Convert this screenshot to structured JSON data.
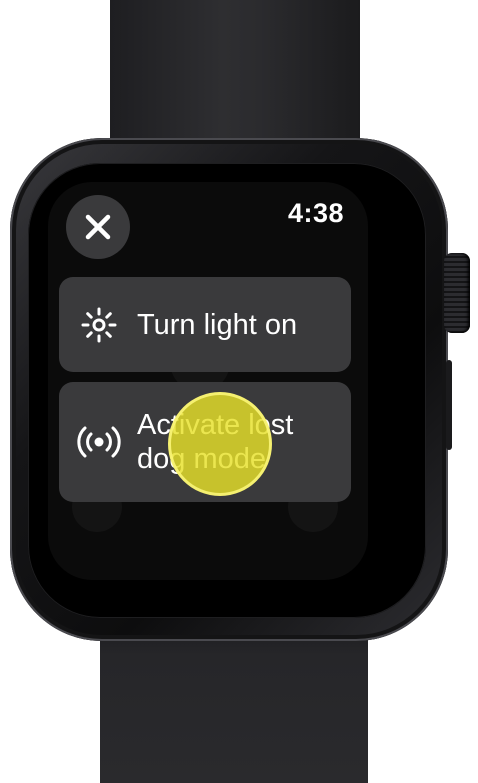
{
  "device": {
    "name": "watch"
  },
  "status_bar": {
    "time": "4:38"
  },
  "close_button": {
    "icon": "close-icon"
  },
  "actions": [
    {
      "label": "Turn light on",
      "icon": "light-icon"
    },
    {
      "label": "Activate lost dog mode",
      "icon": "broadcast-icon"
    }
  ],
  "touch_indicator": {
    "color": "#E6E128"
  },
  "colors": {
    "card_background": "#3A3A3C",
    "screen_background": "#0B0B0B",
    "text": "#FFFFFF"
  }
}
